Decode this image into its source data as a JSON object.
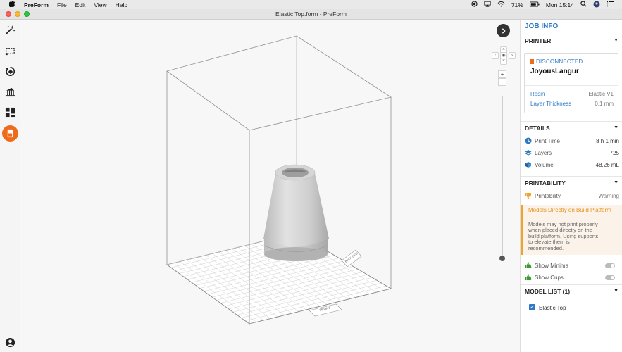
{
  "menubar": {
    "apple": "",
    "app_name": "PreForm",
    "menus": [
      "File",
      "Edit",
      "View",
      "Help"
    ],
    "battery": "71%",
    "clock": "Mon 15:14"
  },
  "window": {
    "title": "Elastic Top.form - PreForm"
  },
  "left_toolbar": {
    "tools": [
      "magic-wand",
      "select",
      "orient",
      "supports",
      "layout",
      "job-info"
    ],
    "account": "account"
  },
  "viewport": {
    "plate_labels": [
      "FRONT",
      "BACK SIDE"
    ]
  },
  "panel": {
    "title": "JOB INFO",
    "printer": {
      "header": "PRINTER",
      "status": "DISCONNECTED",
      "name": "JoyousLangur",
      "resin_label": "Resin",
      "resin_value": "Elastic V1",
      "layer_label": "Layer Thickness",
      "layer_value": "0.1 mm"
    },
    "details": {
      "header": "DETAILS",
      "print_time_label": "Print Time",
      "print_time_value": "8 h 1 min",
      "layers_label": "Layers",
      "layers_value": "725",
      "volume_label": "Volume",
      "volume_value": "48.26 mL"
    },
    "printability": {
      "header": "PRINTABILITY",
      "label": "Printability",
      "value": "Warning",
      "warning_title": "Models Directly on Build Platform",
      "warning_body": "Models may not print properly when placed directly on the build platform. Using supports to elevate them is recommended.",
      "show_minima": "Show Minima",
      "show_cups": "Show Cups"
    },
    "model_list": {
      "header": "MODEL LIST (1)",
      "items": [
        "Elastic Top"
      ]
    }
  },
  "colors": {
    "accent": "#2f7ac5",
    "orange": "#ef6b1c",
    "warning": "#f0a22b",
    "green": "#3a9a2f"
  }
}
